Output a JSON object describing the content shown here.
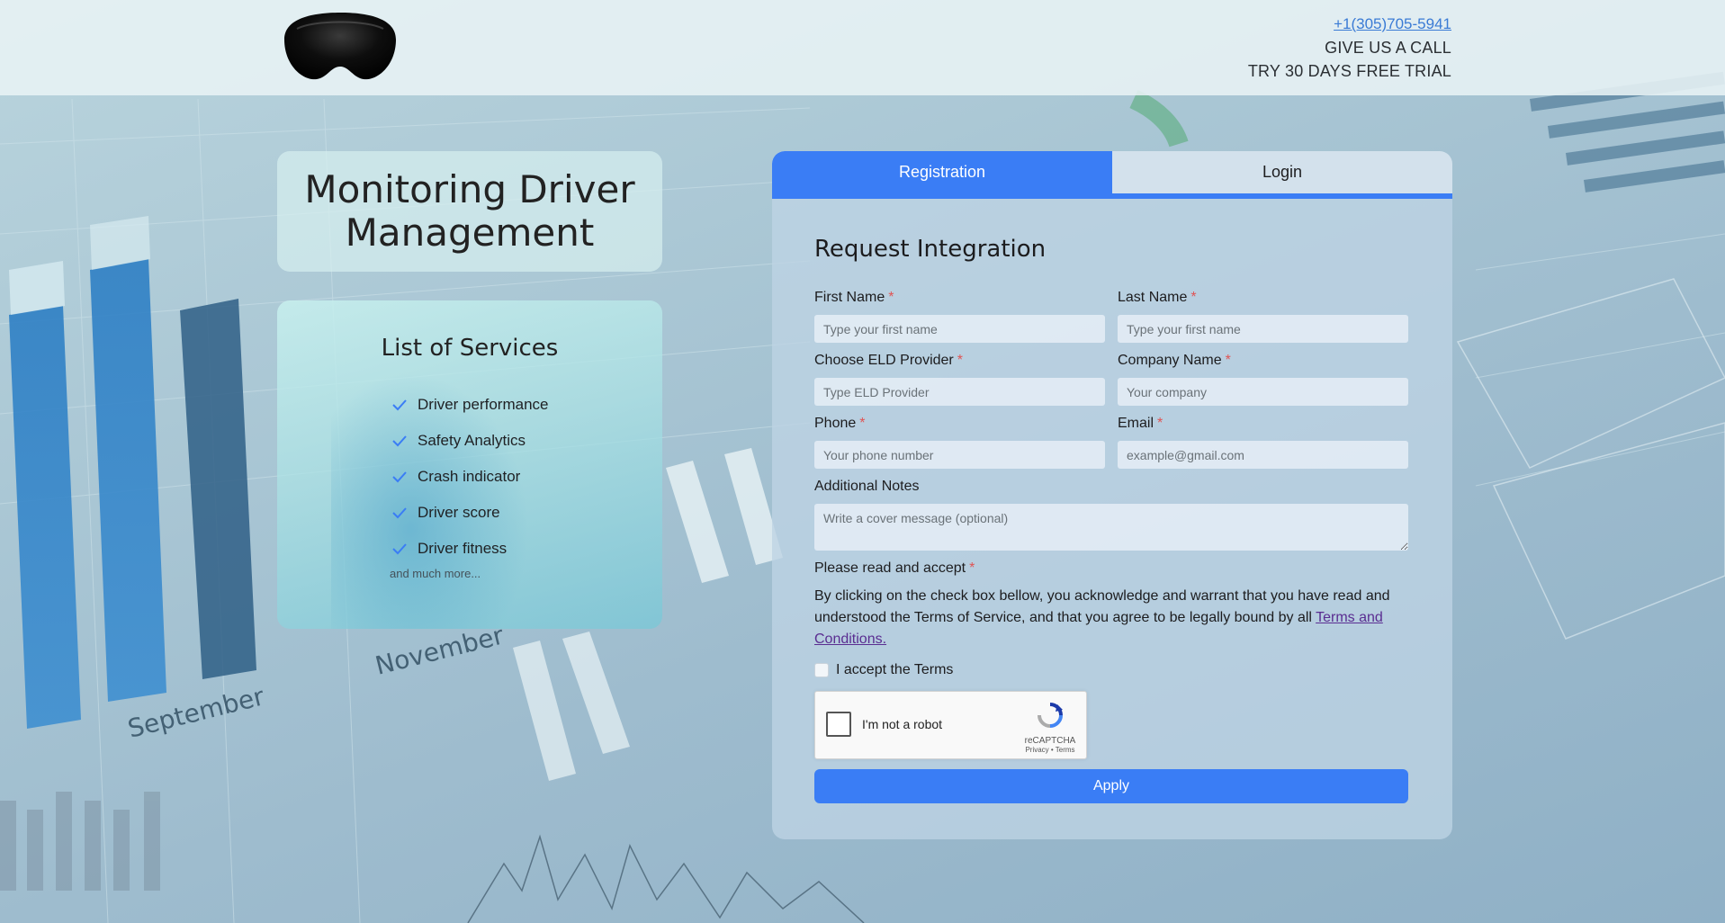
{
  "header": {
    "phone": "+1(305)705-5941",
    "call_text": "GIVE US A CALL",
    "trial_text": "TRY 30 DAYS FREE TRIAL"
  },
  "hero": {
    "title": "Monitoring Driver Management"
  },
  "services": {
    "title": "List of Services",
    "items": [
      "Driver performance",
      "Safety Analytics",
      "Crash indicator",
      "Driver score",
      "Driver fitness"
    ],
    "more": "and much more..."
  },
  "tabs": {
    "registration": "Registration",
    "login": "Login"
  },
  "form": {
    "title": "Request Integration",
    "first_name": {
      "label": "First Name",
      "placeholder": "Type your first name"
    },
    "last_name": {
      "label": "Last Name",
      "placeholder": "Type your first name"
    },
    "eld": {
      "label": "Choose ELD Provider",
      "placeholder": "Type ELD Provider"
    },
    "company": {
      "label": "Company Name",
      "placeholder": "Your company"
    },
    "phone": {
      "label": "Phone",
      "placeholder": "Your phone number"
    },
    "email": {
      "label": "Email",
      "placeholder": "example@gmail.com"
    },
    "notes": {
      "label": "Additional Notes",
      "placeholder": "Write a cover message (optional)"
    },
    "required_mark": "*",
    "accept_label": "Please read and accept",
    "accept_text": "By clicking on the check box bellow, you acknowledge and warrant that you have read and understood the Terms of Service, and that you agree to be legally bound by all",
    "terms_link": "Terms and Conditions.",
    "accept_checkbox": "I accept the Terms",
    "captcha": {
      "text": "I'm not a robot",
      "brand": "reCAPTCHA",
      "links": "Privacy • Terms"
    },
    "submit": "Apply"
  },
  "colors": {
    "accent": "#3a7df5",
    "required": "#e05454",
    "link": "#5a2d91"
  }
}
